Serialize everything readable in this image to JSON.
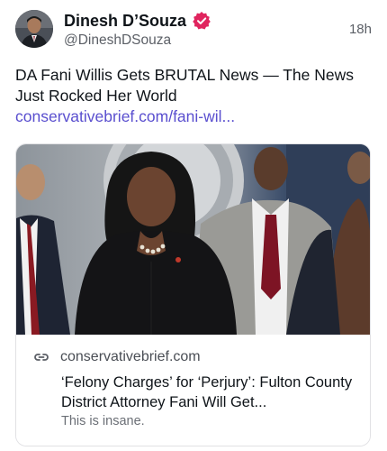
{
  "author": {
    "display_name": "Dinesh D’Souza",
    "handle": "@DineshDSouza",
    "verified": true,
    "avatar_icon": "profile-photo"
  },
  "timestamp": "18h",
  "post": {
    "text": "DA Fani Willis Gets BRUTAL News — The News Just Rocked Her World",
    "link_text": "conservativebrief.com/fani-wil..."
  },
  "link_card": {
    "domain": "conservativebrief.com",
    "title": "‘Felony Charges’ for ‘Perjury’: Fulton County District Attorney Fani Will Get...",
    "description": "This is insane.",
    "icon": "link-icon"
  },
  "colors": {
    "link": "#5a4fcf",
    "verified_badge": "#e0245e",
    "secondary_text": "#5b5f66"
  }
}
